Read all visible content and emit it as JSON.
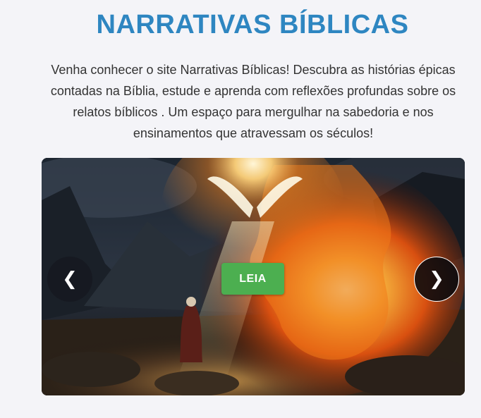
{
  "header": {
    "title": "NARRATIVAS BÍBLICAS",
    "intro": "Venha conhecer o site Narrativas Bíblicas! Descubra as histórias épicas contadas na Bíblia, estude e aprenda com reflexões profundas sobre os relatos bíblicos . Um espaço para mergulhar na sabedoria e nos ensinamentos que atravessam os séculos!"
  },
  "carousel": {
    "cta_label": "LEIA",
    "prev_symbol": "❮",
    "next_symbol": "❯",
    "slide_image": "burning-bush-scene"
  },
  "colors": {
    "title": "#2e86c1",
    "cta": "#4caf50",
    "background": "#f4f4f8"
  }
}
